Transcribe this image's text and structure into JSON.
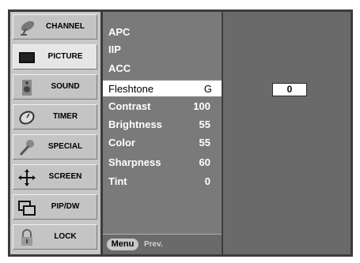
{
  "tabs": [
    {
      "label": "CHANNEL",
      "icon": "satellite-dish-icon",
      "active": false
    },
    {
      "label": "PICTURE",
      "icon": "screen-icon",
      "active": true
    },
    {
      "label": "SOUND",
      "icon": "speaker-icon",
      "active": false
    },
    {
      "label": "TIMER",
      "icon": "clock-icon",
      "active": false
    },
    {
      "label": "SPECIAL",
      "icon": "wrench-icon",
      "active": false
    },
    {
      "label": "SCREEN",
      "icon": "move-arrows-icon",
      "active": false
    },
    {
      "label": "PIP/DW",
      "icon": "pip-icon",
      "active": false
    },
    {
      "label": "LOCK",
      "icon": "padlock-icon",
      "active": false
    }
  ],
  "items": [
    {
      "label": "APC",
      "value": ""
    },
    {
      "label": "IIP",
      "value": ""
    },
    {
      "label": "ACC",
      "value": ""
    },
    {
      "label": "Fleshtone",
      "value": "G"
    },
    {
      "label": "Contrast",
      "value": "100"
    },
    {
      "label": "Brightness",
      "value": "55"
    },
    {
      "label": "Color",
      "value": "55"
    },
    {
      "label": "Sharpness",
      "value": "60"
    },
    {
      "label": "Tint",
      "value": "0"
    }
  ],
  "selected_index": 3,
  "footer": {
    "menu_label": "Menu",
    "prev_label": "Prev."
  },
  "value_box": "0",
  "colors": {
    "panel": "#3c3c3c",
    "list": "#7a7a7a",
    "tab": "#c4c4c4",
    "tab_active": "#e6e6e6"
  }
}
